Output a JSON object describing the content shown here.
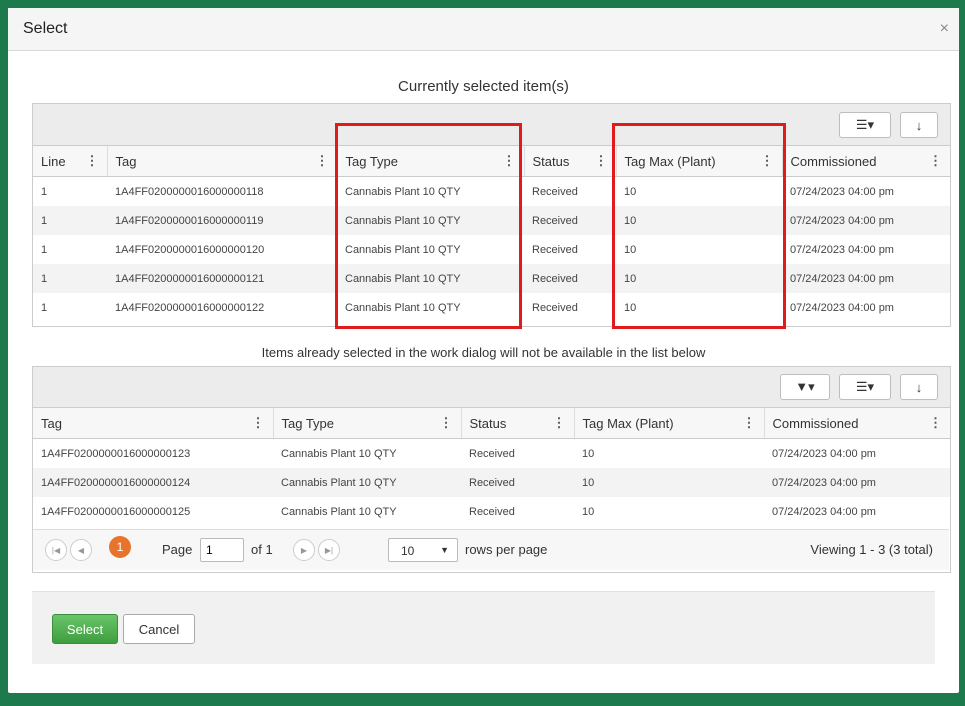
{
  "dialog": {
    "title": "Select",
    "close": "×"
  },
  "selected": {
    "heading": "Currently selected item(s)",
    "toolbar": {
      "columns_icon": "☰▾",
      "download_icon": "↓"
    },
    "columns": [
      "Line",
      "Tag",
      "Tag Type",
      "Status",
      "Tag Max (Plant)",
      "Commissioned"
    ],
    "rows": [
      [
        "1",
        "1A4FF0200000016000000118",
        "Cannabis Plant 10 QTY",
        "Received",
        "10",
        "07/24/2023 04:00 pm"
      ],
      [
        "1",
        "1A4FF0200000016000000119",
        "Cannabis Plant 10 QTY",
        "Received",
        "10",
        "07/24/2023 04:00 pm"
      ],
      [
        "1",
        "1A4FF0200000016000000120",
        "Cannabis Plant 10 QTY",
        "Received",
        "10",
        "07/24/2023 04:00 pm"
      ],
      [
        "1",
        "1A4FF0200000016000000121",
        "Cannabis Plant 10 QTY",
        "Received",
        "10",
        "07/24/2023 04:00 pm"
      ],
      [
        "1",
        "1A4FF0200000016000000122",
        "Cannabis Plant 10 QTY",
        "Received",
        "10",
        "07/24/2023 04:00 pm"
      ]
    ]
  },
  "note": "Items already selected in the work dialog will not be available in the list below",
  "available": {
    "toolbar": {
      "filter_icon": "▼▾",
      "columns_icon": "☰▾",
      "download_icon": "↓"
    },
    "columns": [
      "Tag",
      "Tag Type",
      "Status",
      "Tag Max (Plant)",
      "Commissioned"
    ],
    "rows": [
      [
        "1A4FF0200000016000000123",
        "Cannabis Plant 10 QTY",
        "Received",
        "10",
        "07/24/2023 04:00 pm"
      ],
      [
        "1A4FF0200000016000000124",
        "Cannabis Plant 10 QTY",
        "Received",
        "10",
        "07/24/2023 04:00 pm"
      ],
      [
        "1A4FF0200000016000000125",
        "Cannabis Plant 10 QTY",
        "Received",
        "10",
        "07/24/2023 04:00 pm"
      ]
    ],
    "pager": {
      "first": "|◀",
      "prev": "◀",
      "current_page_badge": "1",
      "page_label": "Page",
      "page_value": "1",
      "of_label": "of 1",
      "next": "▶",
      "last": "▶|",
      "rows_value": "10",
      "rows_label": "rows per page",
      "viewing": "Viewing 1 - 3 (3 total)"
    }
  },
  "footer": {
    "select_label": "Select",
    "cancel_label": "Cancel"
  },
  "colors": {
    "window_frame": "#1c7a4c",
    "highlight": "#e01b1b",
    "select_button": "#4caf50",
    "page_badge": "#e8732a"
  }
}
